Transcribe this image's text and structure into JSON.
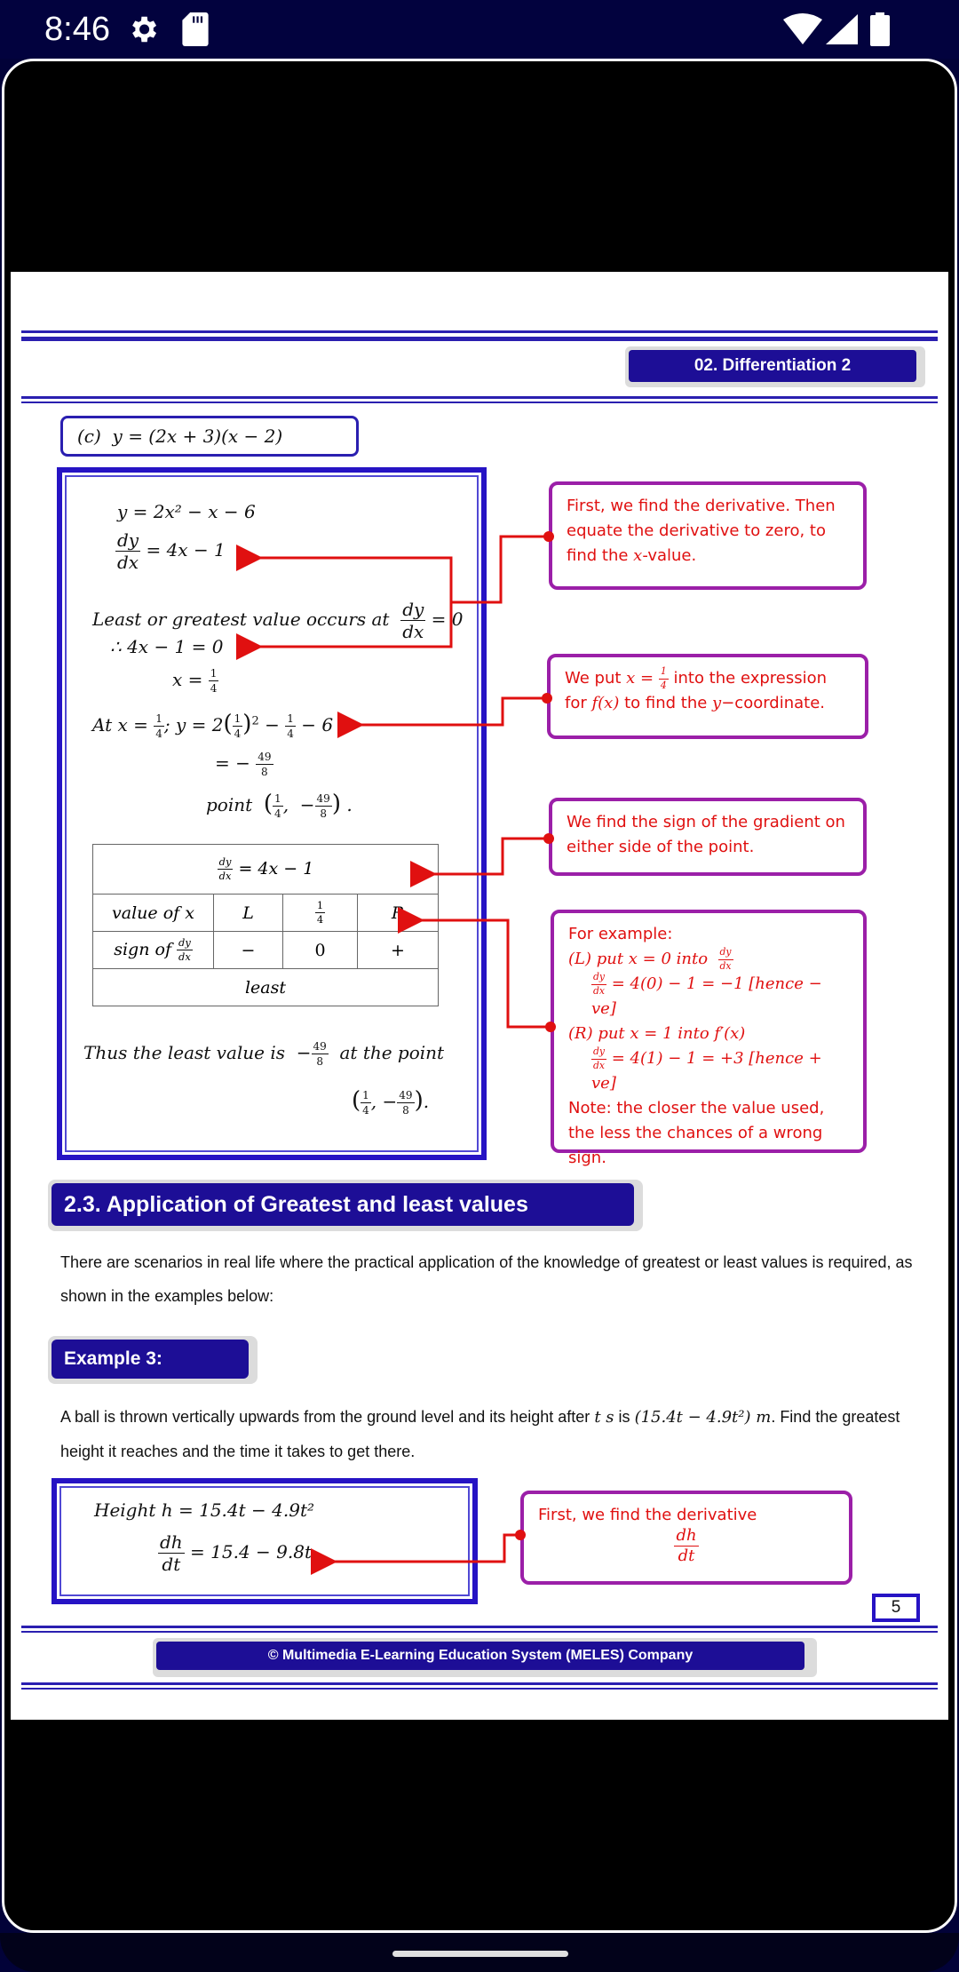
{
  "status_bar": {
    "time": "8:46",
    "icons": [
      "gear-icon",
      "sd-card-icon",
      "wifi-icon",
      "signal-icon",
      "battery-icon"
    ]
  },
  "header": {
    "chapter": "02. Differentiation 2"
  },
  "problem": {
    "label": "(c)",
    "equation": "y  =  (2x + 3)(x − 2)"
  },
  "working": {
    "line1": "y  =  2x² − x − 6",
    "line2_lhs_num": "dy",
    "line2_lhs_den": "dx",
    "line2_rhs": "=   4x  −  1",
    "line3_text": "Least or greatest value occurs at",
    "line3_rhs": "= 0",
    "line4": "∴  4x − 1  =  0",
    "line5_lhs": "x   =",
    "line5_num": "1",
    "line5_den": "4",
    "line6_prefix": "At  x  =",
    "line6_mid": ";   y  =  2",
    "line6_tail": "−",
    "line6_end": "− 6",
    "line7": "= −",
    "value_num": "49",
    "value_den": "8",
    "point_label": "point",
    "quarter_num": "1",
    "quarter_den": "4",
    "conclusion_text": "Thus the least value is",
    "conclusion_tail": "at the point"
  },
  "sign_table": {
    "header": "= 4x − 1",
    "row1": [
      "value of x",
      "L",
      "1/4",
      "R"
    ],
    "row2_label": "sign of",
    "row2": [
      "−",
      "0",
      "+"
    ],
    "result": "least"
  },
  "notes": {
    "note1": "First, we find the derivative. Then equate the derivative to zero, to find the",
    "note1_var": "x",
    "note1_end": "-value.",
    "note2_a": "We put",
    "note2_b": "into the expression for",
    "note2_fx": "f(x)",
    "note2_c": "to find the",
    "note2_y": "y",
    "note2_d": "−coordinate.",
    "note3": "We find the sign of the gradient on either side of the point.",
    "note4_title": "For example:",
    "note4_l1": "(L)  put  x = 0  into",
    "note4_l2": "=  4(0) − 1 = −1  [hence − ve]",
    "note4_l3": "(R) put x = 1 into f′(x)",
    "note4_l4": "= 4(1) − 1 = +3  [hence + ve]",
    "note4_note": "Note: the closer the value used, the less the chances of a wrong sign.",
    "note5": "First, we find the derivative",
    "note5_num": "dh",
    "note5_den": "dt"
  },
  "section": {
    "title": "2.3. Application of Greatest and least values",
    "intro": "There are scenarios in real life where the practical application of the knowledge of greatest or least values is required, as shown in the examples below:"
  },
  "example": {
    "title": "Example 3:",
    "text_a": "A ball is thrown vertically upwards from the ground level and its height after",
    "text_t": "t s",
    "text_b": "is",
    "text_expr": "(15.4t − 4.9t²) m",
    "text_c": ". Find the greatest height it reaches and the time it takes to get there.",
    "line1": "Height  h  =  15.4t  −  4.9t²",
    "line2_num": "dh",
    "line2_den": "dt",
    "line2_rhs": "=   15.4  −  9.8t"
  },
  "footer": {
    "page_number": "5",
    "copyright": "© Multimedia E-Learning Education System (MELES) Company"
  },
  "colors": {
    "brand_blue": "#1d0e96",
    "note_border": "#9b1fa8",
    "note_text": "#e01010",
    "status_bar": "#02023e"
  }
}
